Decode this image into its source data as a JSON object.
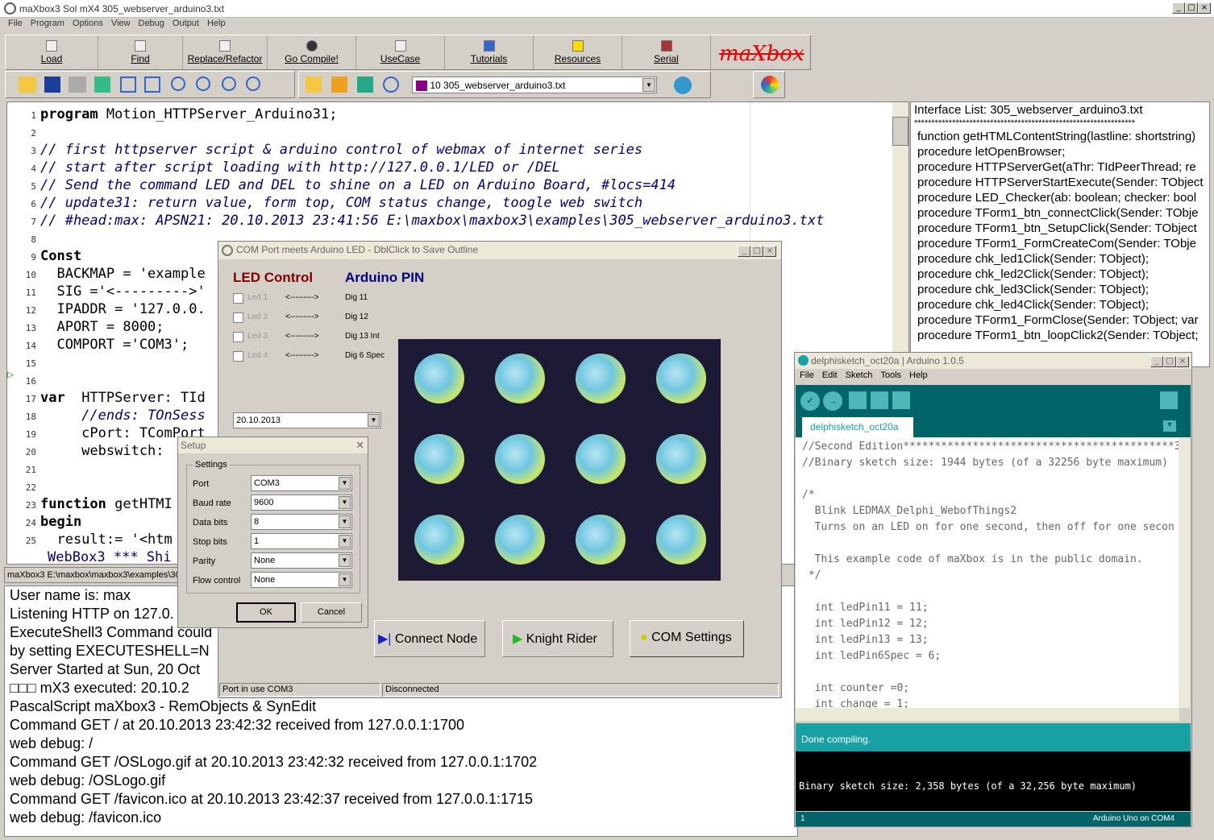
{
  "window": {
    "title": "maXbox3 Sol mX4  305_webserver_arduino3.txt"
  },
  "menu": [
    "File",
    "Program",
    "Options",
    "View",
    "Debug",
    "Output",
    "Help"
  ],
  "toolbar": {
    "buttons": [
      "Load",
      "Find",
      "Replace/Refactor",
      "Go Compile!",
      "UseCase",
      "Tutorials",
      "Resources",
      "Serial"
    ],
    "logo": "maXbox",
    "file_combo": "10  305_webserver_arduino3.txt"
  },
  "editor": {
    "lines": [
      {
        "n": "1",
        "t": "program Motion_HTTPServer_Arduino31;"
      },
      {
        "n": "2",
        "t": ""
      },
      {
        "n": "3",
        "t": "// first httpserver script & arduino control of webmax of internet series"
      },
      {
        "n": "4",
        "t": "// start after script loading with http://127.0.0.1/LED or /DEL"
      },
      {
        "n": "5",
        "t": "// Send the command LED and DEL to shine on a LED on Arduino Board, #locs=414"
      },
      {
        "n": "6",
        "t": "// update31: return value, form top, COM status change, toogle web switch"
      },
      {
        "n": "7",
        "t": "// #head:max: APSN21: 20.10.2013 23:41:56 E:\\maxbox\\maxbox3\\examples\\305_webserver_arduino3.txt"
      },
      {
        "n": "8",
        "t": ""
      },
      {
        "n": "9",
        "t": "Const"
      },
      {
        "n": "10",
        "t": "  BACKMAP = 'example"
      },
      {
        "n": "11",
        "t": "  SIG ='<--------->'"
      },
      {
        "n": "12",
        "t": "  IPADDR = '127.0.0."
      },
      {
        "n": "13",
        "t": "  APORT = 8000;"
      },
      {
        "n": "14",
        "t": "  COMPORT ='COM3';"
      },
      {
        "n": "15",
        "t": ""
      },
      {
        "n": "16",
        "t": ""
      },
      {
        "n": "17",
        "t": "var  HTTPServer: TId"
      },
      {
        "n": "18",
        "t": "     //ends: TOnSess"
      },
      {
        "n": "19",
        "t": "     cPort: TComPort"
      },
      {
        "n": "20",
        "t": "     webswitch: "
      },
      {
        "n": "21",
        "t": ""
      },
      {
        "n": "22",
        "t": ""
      },
      {
        "n": "23",
        "t": "function getHTMI"
      },
      {
        "n": "24",
        "t": "begin"
      },
      {
        "n": "25",
        "t": "  result:= '<htm"
      }
    ],
    "status_line": "WebBox3 *** Shi"
  },
  "interface": {
    "title": "Interface List: 305_webserver_arduino3.txt",
    "sep": "****************************************************************",
    "items": [
      "function getHTMLContentString(lastline: shortstring)",
      "procedure letOpenBrowser;",
      "procedure HTTPServerGet(aThr: TIdPeerThread; re",
      "procedure HTTPServerStartExecute(Sender: TObject",
      "procedure LED_Checker(ab: boolean; checker: bool",
      "procedure TForm1_btn_connectClick(Sender: TObje",
      "procedure TForm1_btn_SetupClick(Sender: TObject",
      "procedure TForm1_FormCreateCom(Sender: TObje",
      "procedure chk_led1Click(Sender: TObject);",
      "procedure chk_led2Click(Sender: TObject);",
      "procedure chk_led3Click(Sender: TObject);",
      "procedure chk_led4Click(Sender: TObject);",
      "procedure TForm1_FormClose(Sender: TObject; var",
      "procedure TForm1_btn_loopClick2(Sender: TObject;"
    ]
  },
  "console": {
    "status": "maXbox3 E:\\maxbox\\maxbox3\\examples\\305",
    "lines": [
      "User name is: max",
      "Listening HTTP on 127.0.",
      "ExecuteShell3 Command could",
      "by setting EXECUTESHELL=N",
      "Server Started at Sun, 20 Oct ",
      "□□□  mX3 executed: 20.10.2",
      "PascalScript maXbox3 - RemObjects & SynEdit",
      "Command GET / at 20.10.2013 23:42:32 received from 127.0.0.1:1700",
      "web debug: /",
      "Command GET /OSLogo.gif at 20.10.2013 23:42:32 received from 127.0.0.1:1702",
      "web debug: /OSLogo.gif",
      "Command GET /favicon.ico at 20.10.2013 23:42:37 received from 127.0.0.1:1715",
      "web debug: /favicon.ico"
    ]
  },
  "com": {
    "title": "COM Port meets Arduino LED - DblClick to Save Outline",
    "led_heading": "LED Control",
    "pin_heading": "Arduino PIN",
    "leds": [
      {
        "led": "Led 1",
        "arrow": "<--------->",
        "pin": "Dig 11"
      },
      {
        "led": "Led 2",
        "arrow": "<--------->",
        "pin": "Dig 12"
      },
      {
        "led": "Led 3",
        "arrow": "<--------->",
        "pin": "Dig 13 Int"
      },
      {
        "led": "Led 4",
        "arrow": "<--------->",
        "pin": "Dig 6 Spec"
      }
    ],
    "date": "20.10.2013",
    "btn_connect": "Connect Node",
    "btn_knight": "Knight Rider",
    "btn_com": "COM Settings",
    "status_port": "Port in use COM3",
    "status_conn": "Disconnected"
  },
  "setup": {
    "title": "Setup",
    "group": "Settings",
    "fields": [
      {
        "label": "Port",
        "value": "COM3"
      },
      {
        "label": "Baud rate",
        "value": "9600"
      },
      {
        "label": "Data bits",
        "value": "8"
      },
      {
        "label": "Stop bits",
        "value": "1"
      },
      {
        "label": "Parity",
        "value": "None"
      },
      {
        "label": "Flow control",
        "value": "None"
      }
    ],
    "ok": "OK",
    "cancel": "Cancel"
  },
  "arduino": {
    "title": "delphisketch_oct20a | Arduino 1.0.5",
    "menu": [
      "File",
      "Edit",
      "Sketch",
      "Tools",
      "Help"
    ],
    "tab": "delphisketch_oct20a",
    "code": [
      "//Second Edition*******************************************333",
      "//Binary sketch size: 1944 bytes (of a 32256 byte maximum)",
      "",
      "/*",
      "  Blink LEDMAX_Delphi_WebofThings2",
      "  Turns on an LED on for one second, then off for one secon",
      "",
      "  This example code of maXbox is in the public domain.",
      " */",
      "",
      "  int ledPin11 = 11;",
      "  int ledPin12 = 12;",
      "  int ledPin13 = 13;",
      "  int ledPin6Spec = 6;",
      "",
      "  int counter =0;",
      "  int change = 1;"
    ],
    "status": "Done compiling.",
    "console": "Binary sketch size: 2,358 bytes (of a 32,256 byte maximum)",
    "line": "1",
    "board": "Arduino Uno on COM4"
  },
  "colors": {
    "arduino_teal": "#17a1a5",
    "led_red": "#800000",
    "pin_blue": "#000080"
  }
}
